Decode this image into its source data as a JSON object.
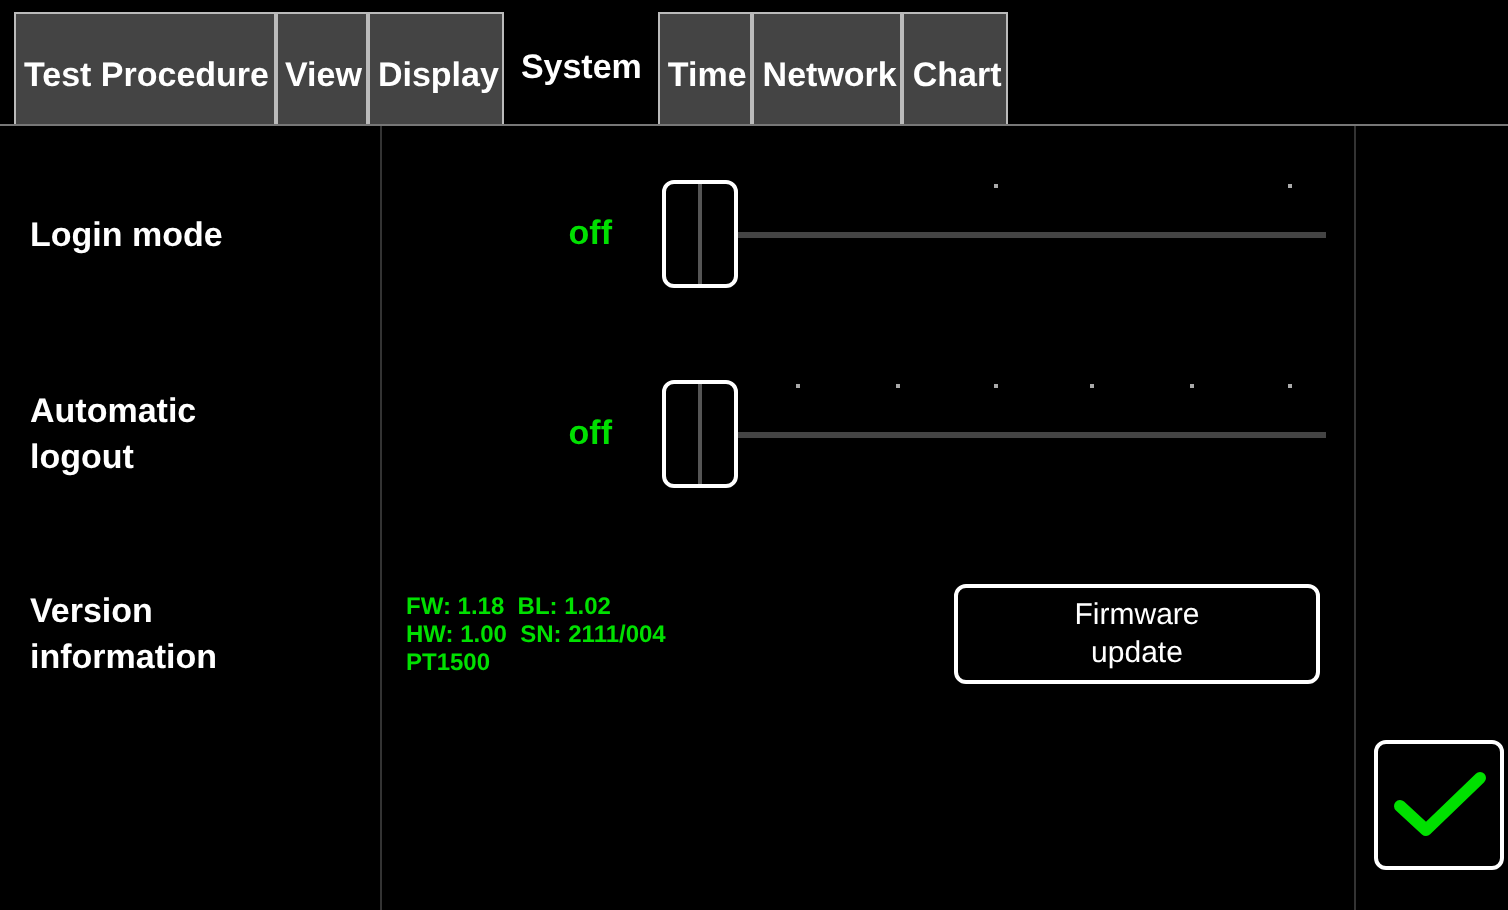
{
  "tabs": [
    {
      "label": "Test Procedure",
      "selected": false
    },
    {
      "label": "View",
      "selected": false
    },
    {
      "label": "Display",
      "selected": false
    },
    {
      "label": "System",
      "selected": true
    },
    {
      "label": "Time",
      "selected": false
    },
    {
      "label": "Network",
      "selected": false
    },
    {
      "label": "Chart",
      "selected": false
    }
  ],
  "settings": [
    {
      "kind": "slider",
      "label": "Login mode",
      "value": "off",
      "level": 0
    },
    {
      "kind": "slider",
      "label": "Automatic logout",
      "value": "off",
      "level": 0
    },
    {
      "kind": "info",
      "label": "Version information",
      "lines": [
        "FW: 1.18  BL: 1.02",
        "HW: 1.00  SN: 2111/004",
        "PT1500"
      ],
      "button": "Firmware update"
    }
  ]
}
